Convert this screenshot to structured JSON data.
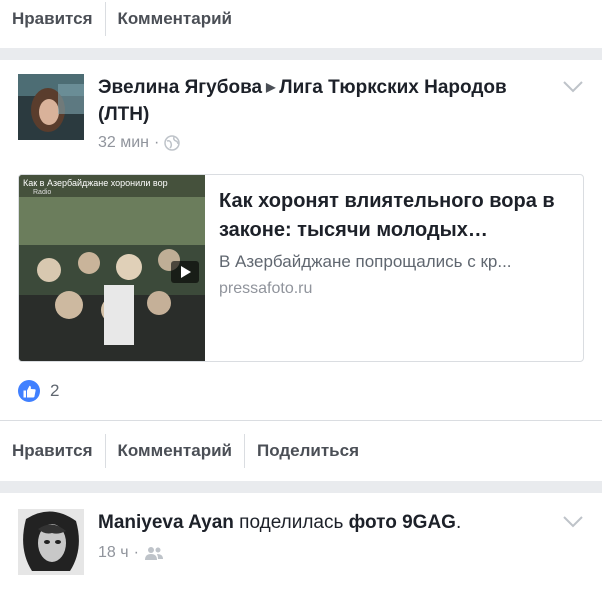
{
  "top_actions": {
    "like": "Нравится",
    "comment": "Комментарий"
  },
  "post1": {
    "author": "Эвелина Ягубова",
    "target": "Лига Тюркских Народов (ЛТН)",
    "time": "32 мин",
    "link": {
      "thumb_caption": "Как в Азербайджане хоронили вор",
      "thumb_sub": "Radio",
      "title": "Как хоронят влиятельного вора в законе: тысячи молодых…",
      "description": "В Азербайджане попрощались с кр...",
      "domain": "pressafoto.ru"
    },
    "like_count": "2",
    "actions": {
      "like": "Нравится",
      "comment": "Комментарий",
      "share": "Поделиться"
    }
  },
  "post2": {
    "author": "Maniyeva Ayan",
    "verb": "поделилась",
    "object": "фото 9GAG",
    "time": "18 ч"
  },
  "colors": {
    "like_blue": "#4080ff",
    "text": "#1d2129",
    "muted": "#90949c"
  }
}
